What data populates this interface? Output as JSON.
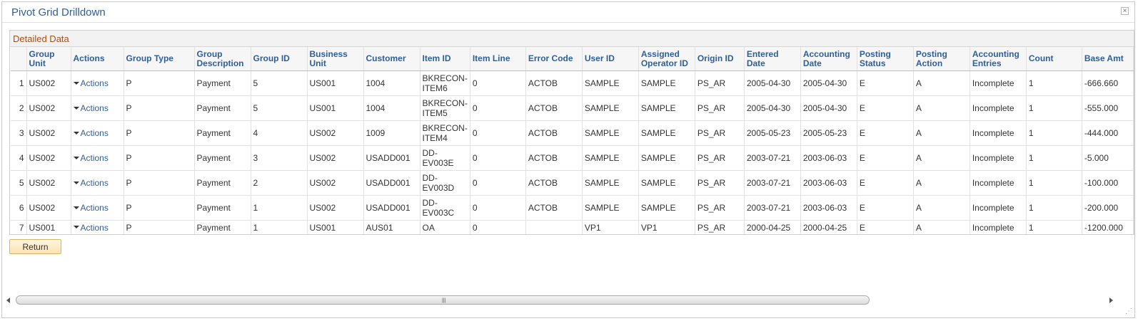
{
  "window": {
    "title": "Pivot Grid Drilldown",
    "close_glyph": "×"
  },
  "grid": {
    "title": "Detailed Data",
    "columns": [
      "",
      "Group Unit",
      "Actions",
      "Group Type",
      "Group Description",
      "Group ID",
      "Business Unit",
      "Customer",
      "Item ID",
      "Item Line",
      "Error Code",
      "User ID",
      "Assigned Operator ID",
      "Origin ID",
      "Entered Date",
      "Accounting Date",
      "Posting Status",
      "Posting Action",
      "Accounting Entries",
      "Count",
      "Base Amt"
    ],
    "rows": [
      [
        "1",
        "US002",
        "Actions",
        "P",
        "Payment",
        "5",
        "US001",
        "1004",
        "BKRECON-ITEM6",
        "0",
        "ACTOB",
        "SAMPLE",
        "SAMPLE",
        "PS_AR",
        "2005-04-30",
        "2005-04-30",
        "E",
        "A",
        "Incomplete",
        "1",
        "-666.660"
      ],
      [
        "2",
        "US002",
        "Actions",
        "P",
        "Payment",
        "5",
        "US001",
        "1004",
        "BKRECON-ITEM5",
        "0",
        "ACTOB",
        "SAMPLE",
        "SAMPLE",
        "PS_AR",
        "2005-04-30",
        "2005-04-30",
        "E",
        "A",
        "Incomplete",
        "1",
        "-555.000"
      ],
      [
        "3",
        "US002",
        "Actions",
        "P",
        "Payment",
        "4",
        "US002",
        "1009",
        "BKRECON-ITEM4",
        "0",
        "ACTOB",
        "SAMPLE",
        "SAMPLE",
        "PS_AR",
        "2005-05-23",
        "2005-05-23",
        "E",
        "A",
        "Incomplete",
        "1",
        "-444.000"
      ],
      [
        "4",
        "US002",
        "Actions",
        "P",
        "Payment",
        "3",
        "US002",
        "USADD001",
        "DD-EV003E",
        "0",
        "ACTOB",
        "SAMPLE",
        "SAMPLE",
        "PS_AR",
        "2003-07-21",
        "2003-06-03",
        "E",
        "A",
        "Incomplete",
        "1",
        "-5.000"
      ],
      [
        "5",
        "US002",
        "Actions",
        "P",
        "Payment",
        "2",
        "US002",
        "USADD001",
        "DD-EV003D",
        "0",
        "ACTOB",
        "SAMPLE",
        "SAMPLE",
        "PS_AR",
        "2003-07-21",
        "2003-06-03",
        "E",
        "A",
        "Incomplete",
        "1",
        "-100.000"
      ],
      [
        "6",
        "US002",
        "Actions",
        "P",
        "Payment",
        "1",
        "US002",
        "USADD001",
        "DD-EV003C",
        "0",
        "ACTOB",
        "SAMPLE",
        "SAMPLE",
        "PS_AR",
        "2003-07-21",
        "2003-06-03",
        "E",
        "A",
        "Incomplete",
        "1",
        "-200.000"
      ],
      [
        "7",
        "US001",
        "Actions",
        "P",
        "Payment",
        "1",
        "US001",
        "AUS01",
        "OA",
        "0",
        "",
        "VP1",
        "VP1",
        "PS_AR",
        "2000-04-25",
        "2000-04-25",
        "E",
        "A",
        "Incomplete",
        "1",
        "-1200.000"
      ]
    ]
  },
  "buttons": {
    "return_label": "Return"
  },
  "scrollbar": {
    "grip": "|||"
  },
  "colors": {
    "title": "#2f5f98",
    "grid_title": "#b04e10",
    "header_text": "#2f5f98",
    "link": "#2f5f98",
    "button_bg": "#fce3b0"
  },
  "icons": {
    "close": "close-icon",
    "actions_dropdown": "caret-down-icon",
    "scroll_left": "scroll-left-icon",
    "scroll_right": "scroll-right-icon",
    "resize": "resize-grip-icon"
  }
}
